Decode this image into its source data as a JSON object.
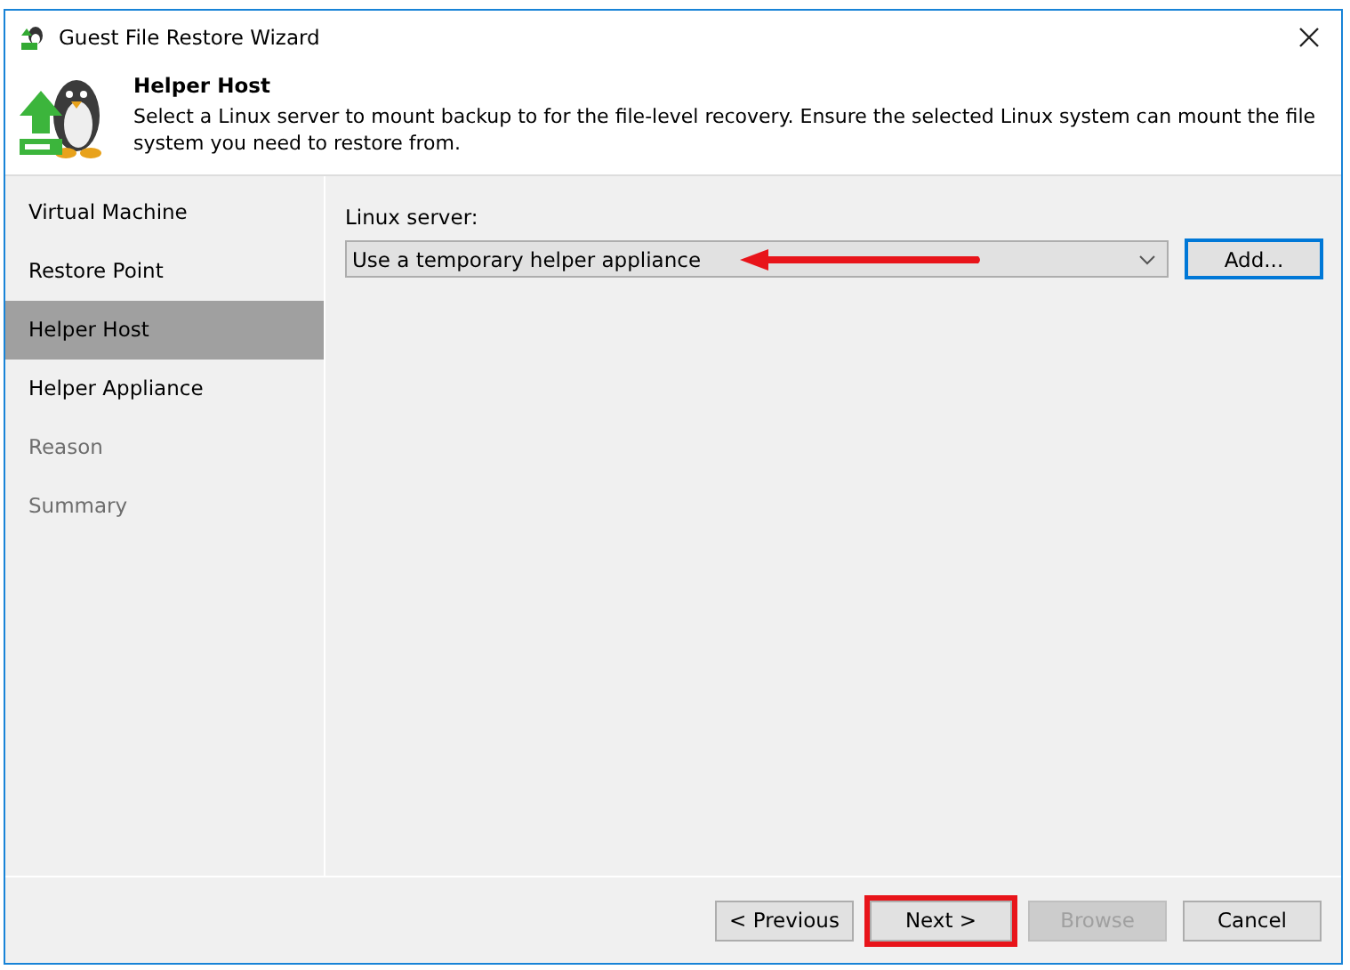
{
  "window": {
    "title": "Guest File Restore Wizard"
  },
  "header": {
    "title": "Helper Host",
    "description": "Select a Linux server to mount backup to for the file-level recovery. Ensure the selected Linux system can mount the file system you need to restore from."
  },
  "steps": [
    {
      "label": "Virtual Machine",
      "selected": false,
      "disabled": false
    },
    {
      "label": "Restore Point",
      "selected": false,
      "disabled": false
    },
    {
      "label": "Helper Host",
      "selected": true,
      "disabled": false
    },
    {
      "label": "Helper Appliance",
      "selected": false,
      "disabled": false
    },
    {
      "label": "Reason",
      "selected": false,
      "disabled": true
    },
    {
      "label": "Summary",
      "selected": false,
      "disabled": true
    }
  ],
  "linux_server": {
    "label": "Linux server:",
    "value": "Use a temporary helper appliance",
    "add_button": {
      "label": "Add...",
      "focused": true
    }
  },
  "buttons": [
    {
      "label": "< Previous",
      "disabled": false,
      "highlighted": false
    },
    {
      "label": "Next >",
      "disabled": false,
      "highlighted": true
    },
    {
      "label": "Browse",
      "disabled": true,
      "highlighted": false
    },
    {
      "label": "Cancel",
      "disabled": false,
      "highlighted": false
    }
  ]
}
